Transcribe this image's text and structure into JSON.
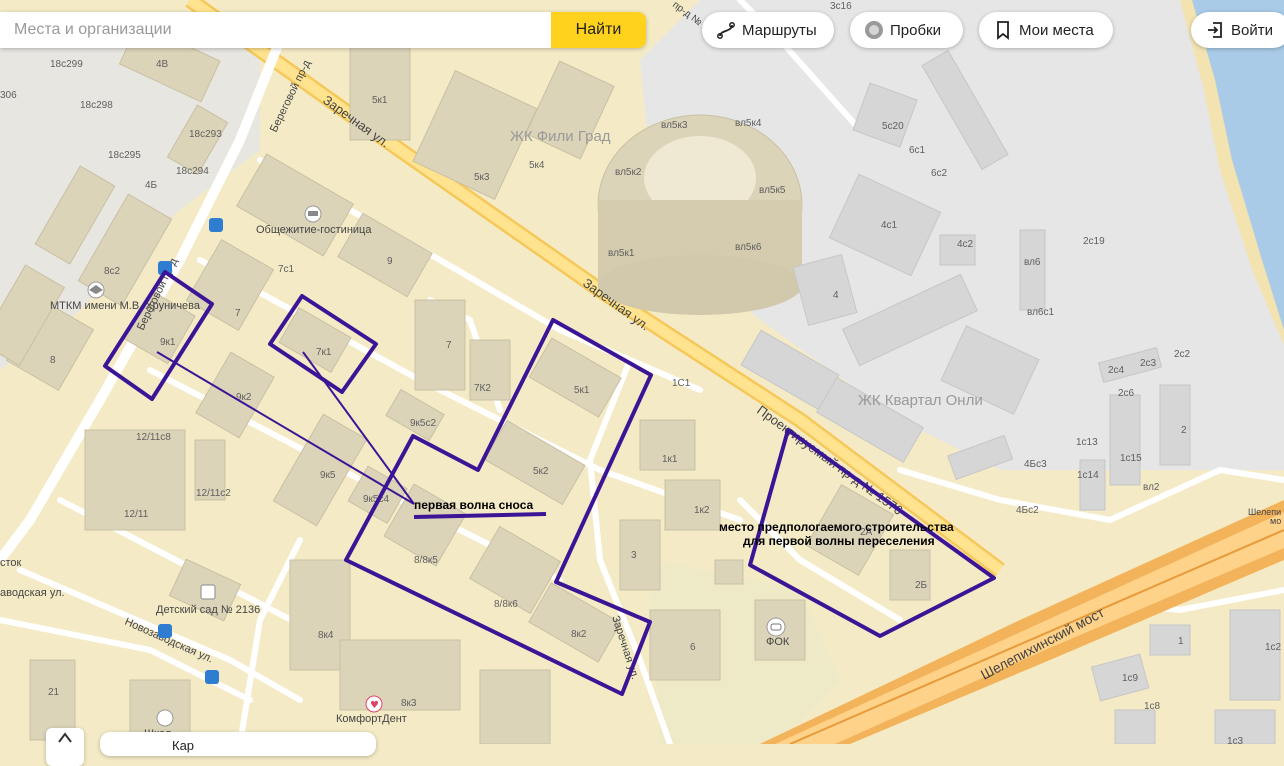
{
  "colors": {
    "land": "#f4ebc6",
    "industrial": "#e6e6e6",
    "building": "#dcd4b9",
    "road": "#ffffff",
    "main_road": "#ffd97a",
    "river": "#a9cbe8",
    "annotation": "#3c1596",
    "highway": "#f2b35a"
  },
  "ui": {
    "search": {
      "placeholder": "Места и организации",
      "button": "Найти"
    },
    "routes": {
      "label": "Маршруты",
      "icon": "route-icon"
    },
    "traffic": {
      "label": "Пробки",
      "icon": "traffic-icon"
    },
    "places": {
      "label": "Мои места",
      "icon": "bookmark-icon"
    },
    "login": {
      "label": "Войти",
      "icon": "login-icon"
    },
    "bottom_text": "Кар"
  },
  "map": {
    "big_labels": {
      "fili_grad": "ЖК Фили Град",
      "kvartal": "ЖК Квартал Онли"
    },
    "streets": {
      "zarechnaya_1": "Заречная ул.",
      "zarechnaya_2": "Заречная ул.",
      "zarechnaya_3": "Заречная ул.",
      "beregovoy_1": "Береговой пр-д",
      "beregovoy_2": "Береговой пр-д",
      "proektiruemy": "Проектируемый пр-д № 1576",
      "shelepikha": "Шелепихинский мост",
      "novozavodskaya": "Новозаводская ул.",
      "zavodskaya": "аводская ул.",
      "pr2": "пр-д № 2",
      "shelepikh_edge": "Шелепи"
    },
    "pois": {
      "hostel": "Общежитие-гостиница",
      "mtkm": "МТКМ имени М.В. Хруничева",
      "kindergarten": "Детский сад № 2136",
      "fok": "ФОК",
      "komfort": "КомфортДент",
      "school": "Школ",
      "stok": "сток"
    },
    "buildings": {
      "b18c299": "18с299",
      "b4v": "4В",
      "b306": "306",
      "b18c298": "18с298",
      "b18c293": "18с293",
      "b18c295": "18с295",
      "b18c294": "18с294",
      "b4b": "4Б",
      "b8c2": "8с2",
      "b8": "8",
      "b5k1a": "5к1",
      "b5k3": "5к3",
      "b5k4": "5к4",
      "b7c1": "7с1",
      "b9": "9",
      "b7a": "7",
      "b9k1": "9к1",
      "b7k1": "7к1",
      "b7b": "7",
      "b7k2": "7К2",
      "b9k2": "9к2",
      "b9k5c2": "9к5с2",
      "b12_11c8": "12/11с8",
      "b12_11c2": "12/11с2",
      "b12_11": "12/11",
      "b9k5": "9к5",
      "b9k5c4": "9к5с4",
      "b8_8k5": "8/8к5",
      "b5k2": "5к2",
      "b5k1b": "5к1",
      "b1c1": "1С1",
      "b1k1": "1к1",
      "b1k2": "1к2",
      "b3": "3",
      "b8_8k6": "8/8к6",
      "b8k2": "8к2",
      "b8k4": "8к4",
      "b8k3": "8к3",
      "b21": "21",
      "b6": "6",
      "b2b": "2Б",
      "b2a": "2А",
      "vl5k3": "вл5к3",
      "vl5k4": "вл5к4",
      "vl5k2": "вл5к2",
      "vl5k5": "вл5к5",
      "vl5k1": "вл5к1",
      "vl5k6": "вл5к6",
      "b5c20": "5с20",
      "b6c1": "6с1",
      "b6c2": "6с2",
      "b4c1": "4с1",
      "b4c2": "4с2",
      "b4": "4",
      "vl6": "вл6",
      "vl6c1": "вл6с1",
      "b2c19": "2с19",
      "b2c4": "2с4",
      "b2c3": "2с3",
      "b2c2": "2с2",
      "b2c6": "2с6",
      "b1c13": "1с13",
      "b1c15": "1с15",
      "b1c14": "1с14",
      "b4b_c3": "4Бс3",
      "b4b_c2": "4Бс2",
      "b2": "2",
      "vl2": "вл2",
      "b1": "1",
      "b1c9": "1с9",
      "b1c8": "1с8",
      "b1c2": "1с2",
      "b1c3": "1с3",
      "b3c16": "3с16"
    },
    "annotations": {
      "first_wave": "первая волна сноса",
      "construction_1": "место предпологаемого строительства",
      "construction_2": "для первой волны переселения"
    }
  }
}
